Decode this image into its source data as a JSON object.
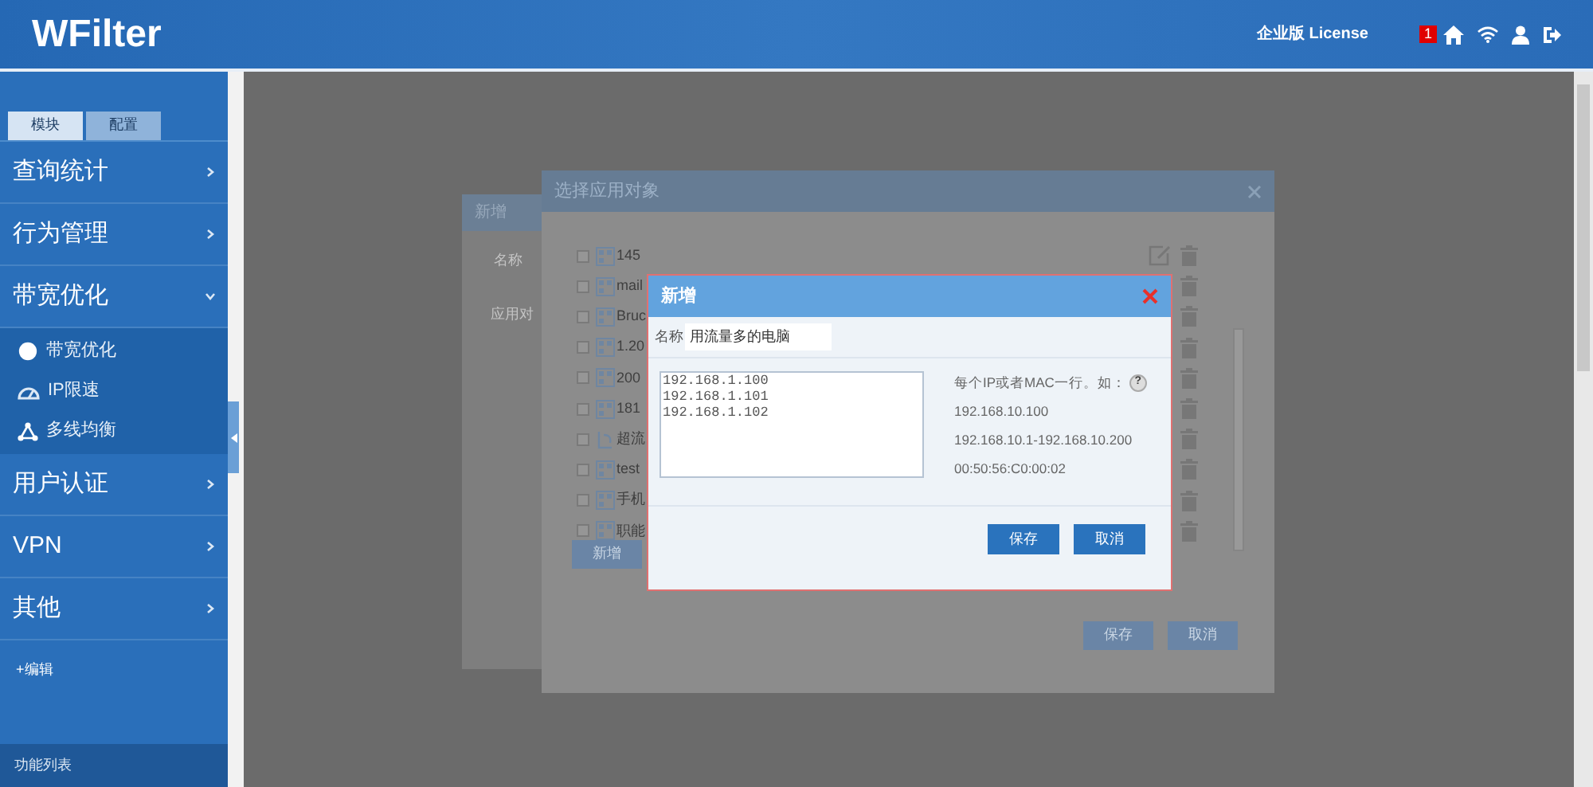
{
  "header": {
    "logo": "WFilter",
    "license": "企业版 License",
    "badge": "1"
  },
  "sidebar": {
    "tabs": [
      {
        "label": "模块",
        "selected": true
      },
      {
        "label": "配置",
        "selected": false
      }
    ],
    "items": [
      {
        "label": "查询统计",
        "expanded": false
      },
      {
        "label": "行为管理",
        "expanded": false
      },
      {
        "label": "带宽优化",
        "expanded": true,
        "children": [
          {
            "label": "带宽优化",
            "kind": "globe"
          },
          {
            "label": "IP限速",
            "kind": "gauge"
          },
          {
            "label": "多线均衡",
            "kind": "network"
          }
        ]
      },
      {
        "label": "用户认证",
        "expanded": false
      },
      {
        "label": "VPN",
        "expanded": false
      },
      {
        "label": "其他",
        "expanded": false
      }
    ],
    "edit_link": "+编辑",
    "footer": "功能列表"
  },
  "background_dialog": {
    "title": "新增",
    "labels": [
      "名称",
      "应用对"
    ]
  },
  "select_dialog": {
    "title": "选择应用对象",
    "items": [
      {
        "label": "145",
        "kind": "group",
        "checked": false,
        "editable": true
      },
      {
        "label": "mail",
        "kind": "group",
        "checked": false
      },
      {
        "label": "Bruc",
        "kind": "group",
        "checked": false
      },
      {
        "label": "1.20",
        "kind": "group",
        "checked": false
      },
      {
        "label": "200",
        "kind": "group",
        "checked": false
      },
      {
        "label": "181",
        "kind": "group",
        "checked": false
      },
      {
        "label": "超流",
        "kind": "special",
        "checked": false
      },
      {
        "label": "test",
        "kind": "group",
        "checked": false
      },
      {
        "label": "手机",
        "kind": "group",
        "checked": false
      },
      {
        "label": "职能",
        "kind": "group",
        "checked": false
      }
    ],
    "new_button": "新增",
    "save_button": "保存",
    "cancel_button": "取消"
  },
  "new_dialog": {
    "title": "新增",
    "name_label": "名称",
    "name_value": "用流量多的电脑",
    "addresses": [
      "192.168.1.100",
      "192.168.1.101",
      "192.168.1.102"
    ],
    "hint": "每个IP或者MAC一行。如：",
    "examples": [
      "192.168.10.100",
      "192.168.10.1-192.168.10.200",
      "00:50:56:C0:00:02"
    ],
    "help_mark": "?",
    "save_button": "保存",
    "cancel_button": "取消"
  }
}
